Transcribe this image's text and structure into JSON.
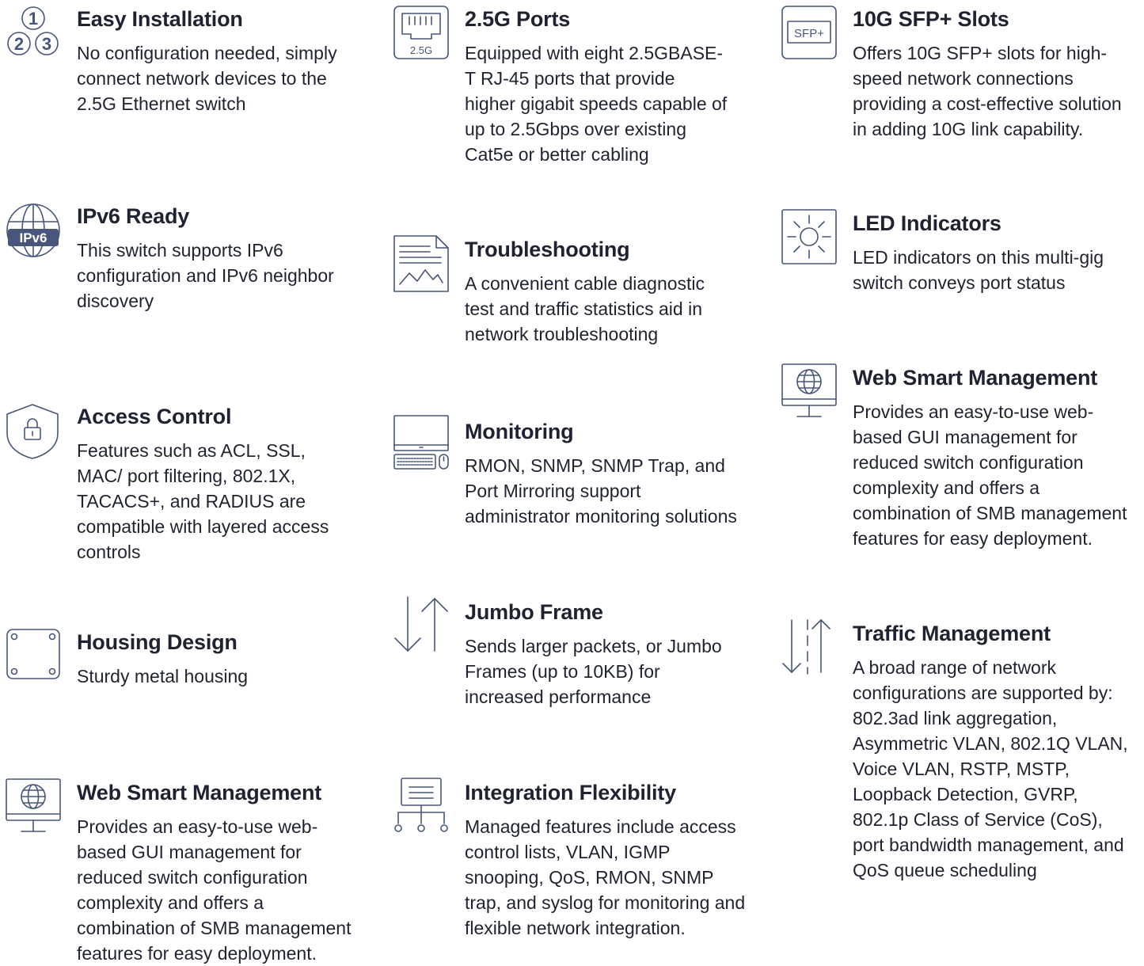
{
  "features": [
    {
      "id": "easy-installation",
      "title": "Easy Installation",
      "description": "No configuration needed, simply connect network devices to the 2.5G Ethernet switch",
      "icon": "steps-123-icon"
    },
    {
      "id": "ipv6-ready",
      "title": "IPv6 Ready",
      "description": "This switch supports IPv6 configuration and IPv6 neighbor discovery",
      "icon": "globe-ipv6-icon",
      "icon_text": "IPv6"
    },
    {
      "id": "access-control",
      "title": "Access Control",
      "description": "Features such as ACL, SSL, MAC/ port filtering, 802.1X, TACACS+, and RADIUS are compatible with layered access controls",
      "icon": "shield-lock-icon"
    },
    {
      "id": "housing-design",
      "title": "Housing Design",
      "description": "Sturdy metal housing",
      "icon": "metal-plate-icon"
    },
    {
      "id": "web-smart-management-left",
      "title": "Web Smart Management",
      "description": "Provides an easy-to-use web-based GUI management for reduced switch configuration complexity and offers a combination of SMB management features for easy deployment.",
      "icon": "monitor-globe-icon"
    },
    {
      "id": "ports-2-5g",
      "title": "2.5G Ports",
      "description": "Equipped with eight 2.5GBASE-T RJ-45 ports that provide higher gigabit speeds capable of up to 2.5Gbps over existing Cat5e or better cabling",
      "icon": "rj45-port-icon",
      "icon_text": "2.5G"
    },
    {
      "id": "troubleshooting",
      "title": "Troubleshooting",
      "description": "A convenient cable diagnostic test and traffic statistics aid in network troubleshooting",
      "icon": "report-chart-icon"
    },
    {
      "id": "monitoring",
      "title": "Monitoring",
      "description": "RMON, SNMP, SNMP Trap, and Port Mirroring support administrator monitoring solutions",
      "icon": "computer-keyboard-mouse-icon"
    },
    {
      "id": "jumbo-frame",
      "title": "Jumbo Frame",
      "description": "Sends larger packets, or Jumbo Frames (up to 10KB) for increased performance",
      "icon": "up-down-arrows-icon"
    },
    {
      "id": "integration-flexibility",
      "title": "Integration Flexibility",
      "description": "Managed features include access control lists, VLAN, IGMP snooping, QoS, RMON, SNMP trap, and syslog for monitoring and flexible network integration.",
      "icon": "network-tree-icon"
    },
    {
      "id": "sfp-slots",
      "title": "10G SFP+ Slots",
      "description": "Offers 10G SFP+ slots for high-speed network connections providing a cost-effective solution in adding 10G link capability.",
      "icon": "sfp-slot-icon",
      "icon_text": "SFP+"
    },
    {
      "id": "led-indicators",
      "title": "LED Indicators",
      "description": "LED indicators on this multi-gig switch conveys port status",
      "icon": "sun-led-icon"
    },
    {
      "id": "web-smart-management-right",
      "title": "Web Smart Management",
      "description": "Provides an easy-to-use web-based GUI management for reduced switch configuration complexity and offers a combination of SMB management features for easy deployment.",
      "icon": "monitor-globe-icon"
    },
    {
      "id": "traffic-management",
      "title": "Traffic Management",
      "description": "A broad range of network configurations are supported by: 802.3ad link aggregation, Asymmetric VLAN, 802.1Q VLAN, Voice VLAN, RSTP, MSTP, Loopback Detection, GVRP, 802.1p Class of Service (CoS), port bandwidth management, and QoS queue scheduling",
      "icon": "traffic-arrows-icon"
    }
  ]
}
